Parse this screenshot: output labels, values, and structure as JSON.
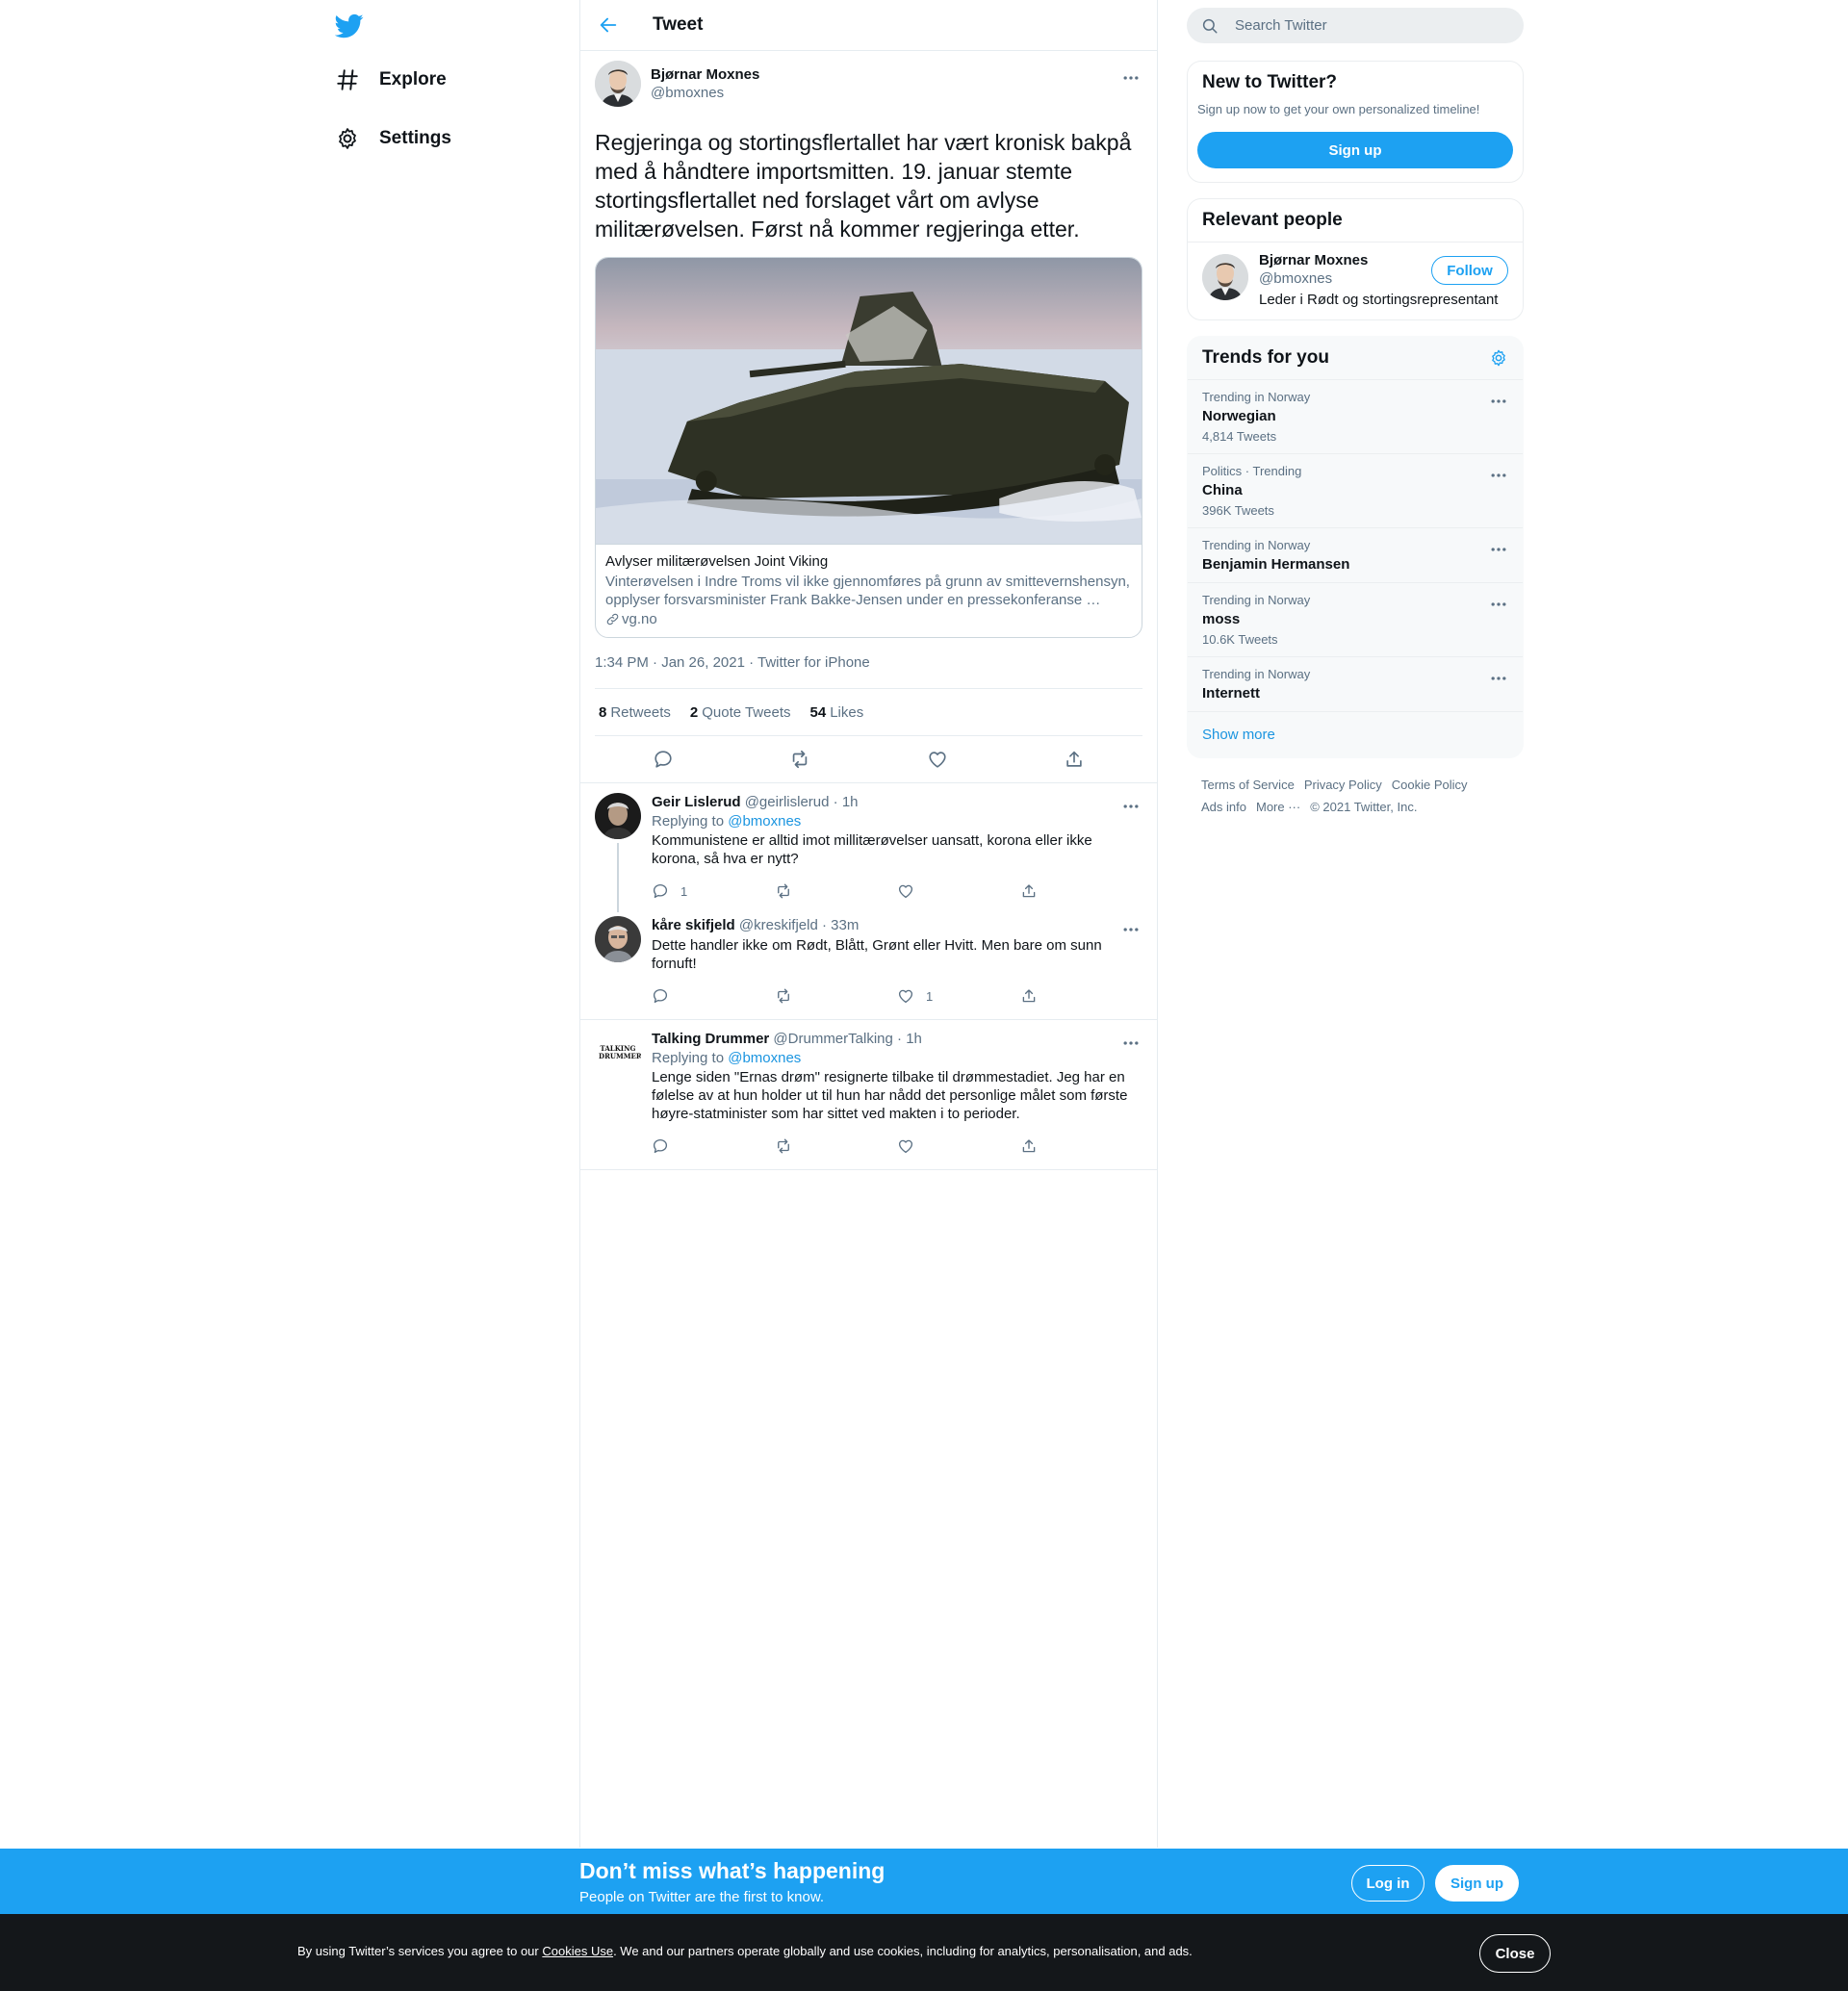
{
  "nav": {
    "logo_icon": "twitter-bird-icon",
    "items": [
      {
        "label": "Explore",
        "icon": "hashtag-icon"
      },
      {
        "label": "Settings",
        "icon": "gear-icon"
      }
    ]
  },
  "header": {
    "title": "Tweet"
  },
  "tweet": {
    "author_name": "Bjørnar Moxnes",
    "author_handle": "@bmoxnes",
    "text": "Regjeringa og stortingsflertallet har vært kronisk bakpå med å håndtere importsmitten. 19. januar stemte stortingsflertallet ned forslaget vårt om avlyse militærøvelsen. Først nå kommer regjeringa etter.",
    "card": {
      "title": "Avlyser militærøvelsen Joint Viking",
      "description": "Vinterøvelsen i Indre Troms vil ikke gjennomføres på grunn av smittevernshensyn, opplyser forsvarsminister Frank Bakke-Jensen under en pressekonferanse …",
      "domain": "vg.no"
    },
    "time": "1:34 PM · Jan 26, 2021",
    "source": "Twitter for iPhone",
    "stats": {
      "retweets_count": "8",
      "retweets_label": "Retweets",
      "quotes_count": "2",
      "quotes_label": "Quote Tweets",
      "likes_count": "54",
      "likes_label": "Likes"
    }
  },
  "replies": [
    {
      "name": "Geir Lislerud",
      "handle": "@geirlislerud",
      "time": "1h",
      "replying_prefix": "Replying to",
      "replying_to": "@bmoxnes",
      "text": "Kommunistene er alltid imot millitærøvelser uansatt, korona eller ikke korona, så hva er nytt?",
      "reply_count": "1",
      "retweet_count": "",
      "like_count": ""
    },
    {
      "name": "kåre skifjeld",
      "handle": "@kreskifjeld",
      "time": "33m",
      "text": "Dette handler ikke om Rødt, Blått, Grønt eller Hvitt. Men bare om sunn fornuft!",
      "reply_count": "",
      "retweet_count": "",
      "like_count": "1"
    },
    {
      "name": "Talking Drummer",
      "handle": "@DrummerTalking",
      "time": "1h",
      "replying_prefix": "Replying to",
      "replying_to": "@bmoxnes",
      "text": "Lenge siden \"Ernas drøm\" resignerte tilbake til drømmestadiet. Jeg har en følelse av at hun holder ut til hun har nådd det personlige målet som første høyre-statminister som har sittet ved makten i to perioder.",
      "avatar_text": "TALKING DRUMMER",
      "reply_count": "",
      "retweet_count": "",
      "like_count": ""
    }
  ],
  "sidebar": {
    "search_placeholder": "Search Twitter",
    "new_to_twitter": {
      "title": "New to Twitter?",
      "subtitle": "Sign up now to get your own personalized timeline!",
      "button": "Sign up"
    },
    "relevant_people": {
      "title": "Relevant people",
      "name": "Bjørnar Moxnes",
      "handle": "@bmoxnes",
      "bio": "Leder i Rødt og stortingsrepresentant",
      "follow": "Follow"
    },
    "trends": {
      "title": "Trends for you",
      "items": [
        {
          "meta": "Trending in Norway",
          "name": "Norwegian",
          "count": "4,814 Tweets"
        },
        {
          "meta": "Politics · Trending",
          "name": "China",
          "count": "396K Tweets"
        },
        {
          "meta": "Trending in Norway",
          "name": "Benjamin Hermansen",
          "count": ""
        },
        {
          "meta": "Trending in Norway",
          "name": "moss",
          "count": "10.6K Tweets"
        },
        {
          "meta": "Trending in Norway",
          "name": "Internett",
          "count": ""
        }
      ],
      "show_more": "Show more"
    },
    "footer": {
      "terms": "Terms of Service",
      "privacy": "Privacy Policy",
      "cookie": "Cookie Policy",
      "ads": "Ads info",
      "more": "More ···",
      "copyright": "© 2021 Twitter, Inc."
    }
  },
  "bottom_bar": {
    "title": "Don’t miss what’s happening",
    "subtitle": "People on Twitter are the first to know.",
    "login": "Log in",
    "signup": "Sign up"
  },
  "cookie_bar": {
    "text_before": "By using Twitter’s services you agree to our ",
    "link": "Cookies Use",
    "text_after": ". We and our partners operate globally and use cookies, including for analytics, personalisation, and ads.",
    "close": "Close"
  },
  "colors": {
    "accent": "#1da1f2",
    "text": "#0f1419",
    "muted": "#5b7083",
    "cookie_bg": "#14171a"
  }
}
